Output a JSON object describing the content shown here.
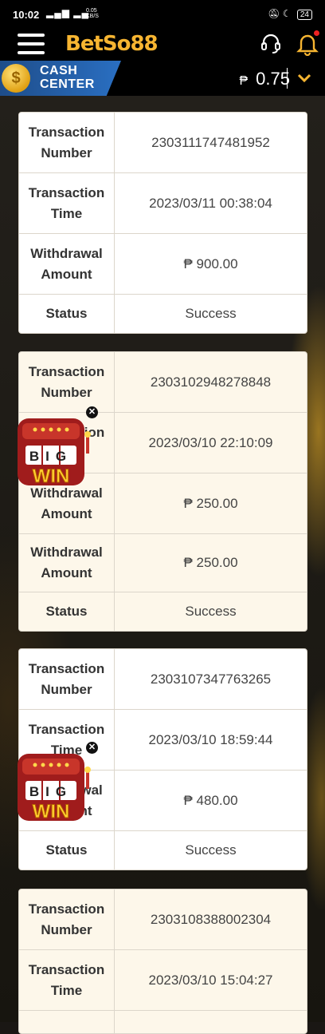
{
  "status_bar": {
    "time": "10:02",
    "network_speed": "0.05",
    "network_unit": "KB/S",
    "battery": "24"
  },
  "header": {
    "brand": "BetSo88"
  },
  "cash_center": {
    "label_line1": "CASH",
    "label_line2": "CENTER",
    "currency_symbol": "₱",
    "balance": "0.75"
  },
  "transactions": [
    {
      "rows": [
        {
          "label": "Transaction Number",
          "value": "2303111747481952"
        },
        {
          "label": "Transaction Time",
          "value": "2023/03/11 00:38:04"
        },
        {
          "label": "Withdrawal Amount",
          "value": "₱ 900.00"
        },
        {
          "label": "Status",
          "value": "Success"
        }
      ]
    },
    {
      "rows": [
        {
          "label": "Transaction Number",
          "value": "2303102948278848"
        },
        {
          "label": "Transaction Time",
          "value": "2023/03/10 22:10:09"
        },
        {
          "label": "Withdrawal Amount",
          "value": "₱ 250.00"
        },
        {
          "label": "Withdrawal Amount",
          "value": "₱ 250.00"
        },
        {
          "label": "Status",
          "value": "Success"
        }
      ]
    },
    {
      "rows": [
        {
          "label": "Transaction Number",
          "value": "2303107347763265"
        },
        {
          "label": "Transaction Time",
          "value": "2023/03/10 18:59:44"
        },
        {
          "label": "Withdrawal Amount",
          "value": "₱ 480.00"
        },
        {
          "label": "Status",
          "value": "Success"
        }
      ]
    },
    {
      "rows": [
        {
          "label": "Transaction Number",
          "value": "2303108388002304"
        },
        {
          "label": "Transaction Time",
          "value": "2023/03/10 15:04:27"
        }
      ]
    }
  ],
  "promo": {
    "line1": "BIG",
    "line2": "WIN"
  },
  "colors": {
    "accent": "#f7b531",
    "cash_tab": "#2a6fc2",
    "card_alt": "#fdf7ea"
  }
}
